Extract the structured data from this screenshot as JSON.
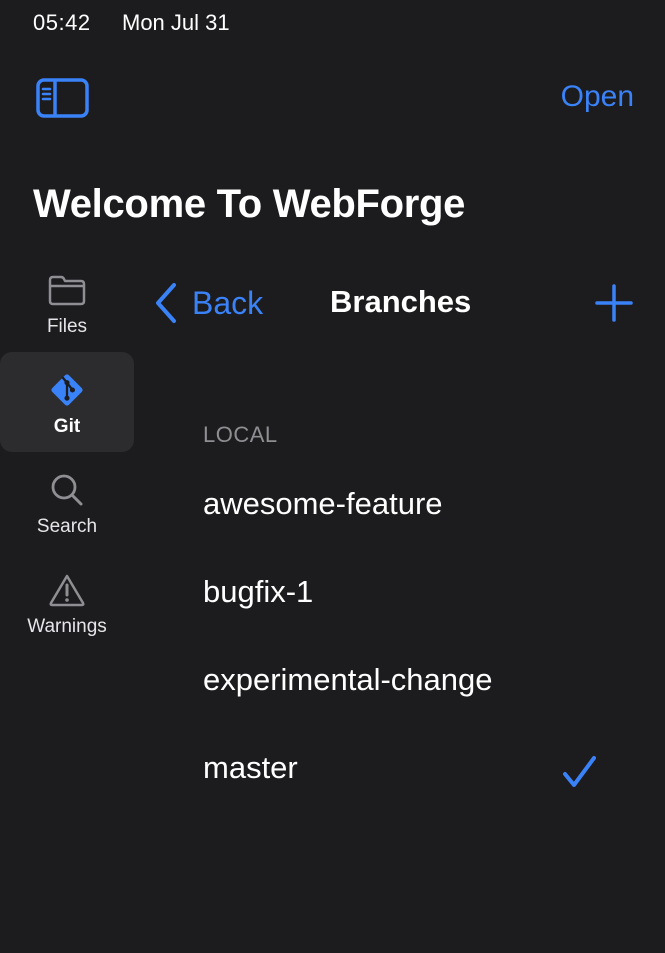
{
  "status_bar": {
    "time": "05:42",
    "date": "Mon Jul 31"
  },
  "header": {
    "sidebar_toggle_icon": "sidebar-left-icon",
    "open_label": "Open",
    "title": "Welcome To WebForge"
  },
  "side_nav": {
    "items": [
      {
        "label": "Files",
        "icon": "folder-icon",
        "active": false
      },
      {
        "label": "Git",
        "icon": "git-icon",
        "active": true
      },
      {
        "label": "Search",
        "icon": "magnifying-glass-icon",
        "active": false
      },
      {
        "label": "Warnings",
        "icon": "warning-triangle-icon",
        "active": false
      }
    ]
  },
  "nav_bar": {
    "back_label": "Back",
    "title": "Branches",
    "add_icon": "plus-icon"
  },
  "branches": {
    "section_label": "LOCAL",
    "items": [
      {
        "name": "awesome-feature",
        "current": false
      },
      {
        "name": "bugfix-1",
        "current": false
      },
      {
        "name": "experimental-change",
        "current": false
      },
      {
        "name": "master",
        "current": true
      }
    ]
  },
  "colors": {
    "background": "#1c1c1e",
    "accent": "#3a82f7",
    "active_nav_bg": "#2c2c2e",
    "secondary_text": "#8e8e93",
    "icon_gray": "#8e8e93"
  }
}
